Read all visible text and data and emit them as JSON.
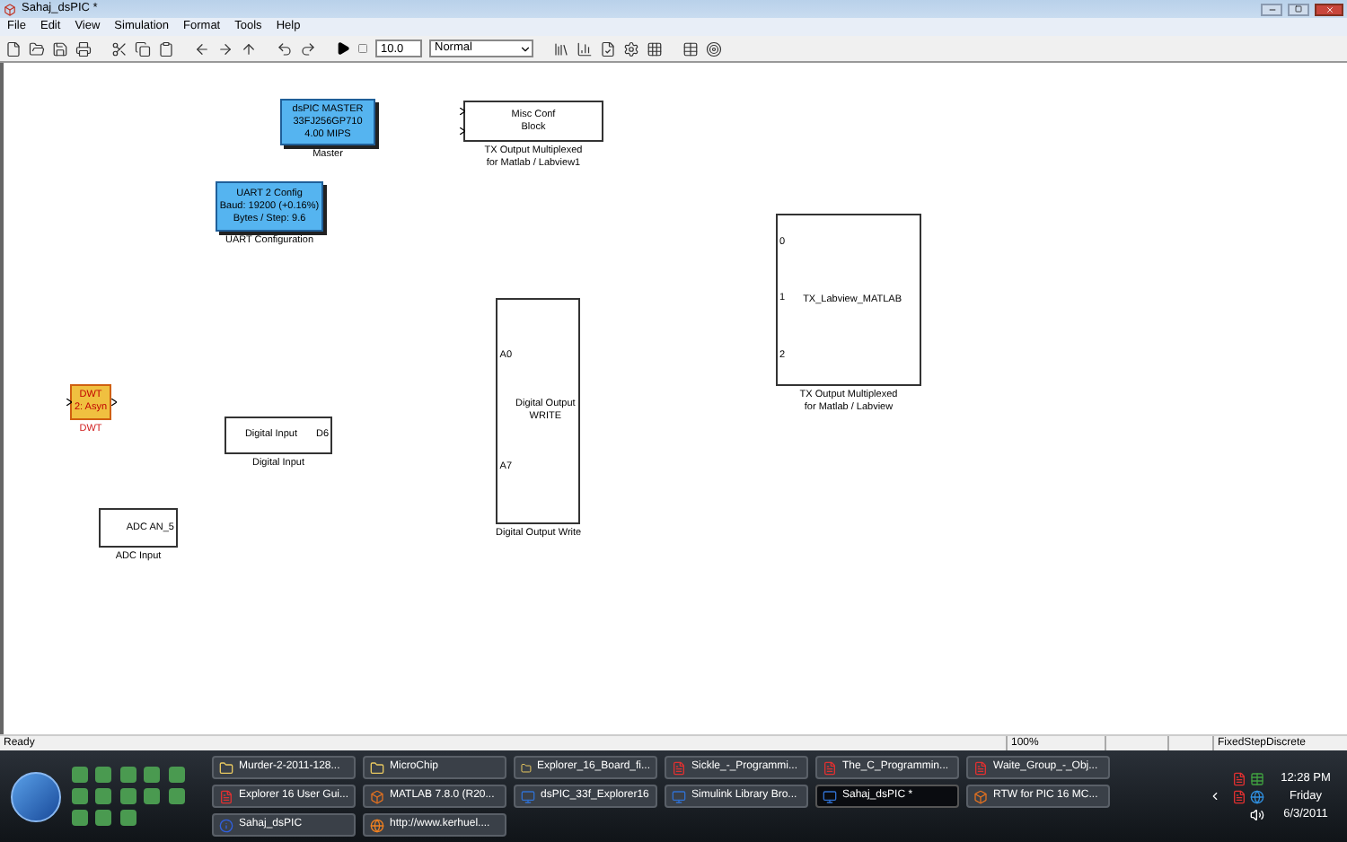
{
  "window": {
    "title": "Sahaj_dsPIC *"
  },
  "menu": [
    "File",
    "Edit",
    "View",
    "Simulation",
    "Format",
    "Tools",
    "Help"
  ],
  "toolbar": {
    "stop_time": "10.0",
    "mode": "Normal"
  },
  "blocks": [
    {
      "kind": "config",
      "lines": [
        "dsPIC MASTER",
        "33FJ256GP710",
        "4.00 MIPS"
      ],
      "label": [
        "Master"
      ]
    },
    {
      "kind": "plain",
      "lines": [
        "Misc Conf",
        "Block"
      ],
      "label": [
        "TX Output Multiplexed",
        "for Matlab / Labview1"
      ]
    },
    {
      "kind": "config",
      "lines": [
        "UART 2 Config",
        "Baud: 19200 (+0.16%)",
        "Bytes / Step: 9.6"
      ],
      "label": [
        "UART Configuration"
      ]
    },
    {
      "kind": "dwt",
      "lines": [
        "DWT",
        "2: Asyn"
      ],
      "label": [
        "DWT"
      ]
    },
    {
      "kind": "plain",
      "lines": [
        "Digital Input"
      ],
      "outputs": [
        "D6"
      ],
      "label": [
        "Digital Input"
      ]
    },
    {
      "kind": "plain",
      "outputs": [
        "ADC AN_5"
      ],
      "label": [
        "ADC Input"
      ]
    },
    {
      "kind": "plain",
      "lines": [
        "Digital Output",
        "WRITE"
      ],
      "inputs": [
        "A0",
        "A7"
      ],
      "label": [
        "Digital Output Write"
      ]
    },
    {
      "kind": "plain",
      "lines": [
        "TX_Labview_MATLAB"
      ],
      "inputs": [
        "0",
        "1",
        "2"
      ],
      "label": [
        "TX Output Multiplexed",
        "for Matlab / Labview"
      ]
    }
  ],
  "status_bar": {
    "message": "Ready",
    "zoom": "100%",
    "solver": "FixedStepDiscrete"
  },
  "taskbar": {
    "tasks": [
      {
        "title": "Murder-2-2011-128...",
        "kind": "folder",
        "selected": false
      },
      {
        "title": "MicroChip",
        "kind": "folder",
        "selected": false
      },
      {
        "title": "Explorer_16_Board_fi...",
        "kind": "folder",
        "selected": false
      },
      {
        "title": "Sickle_-_Programmi...",
        "kind": "pdf",
        "selected": false
      },
      {
        "title": "The_C_Programmin...",
        "kind": "pdf",
        "selected": false
      },
      {
        "title": "Waite_Group_-_Obj...",
        "kind": "pdf",
        "selected": false
      },
      {
        "title": "Explorer 16 User Gui...",
        "kind": "pdf",
        "selected": false
      },
      {
        "title": "MATLAB  7.8.0 (R20...",
        "kind": "matlab",
        "selected": false
      },
      {
        "title": "dsPIC_33f_Explorer16",
        "kind": "simulink",
        "selected": false
      },
      {
        "title": "Simulink Library Bro...",
        "kind": "simulink",
        "selected": false
      },
      {
        "title": "Sahaj_dsPIC *",
        "kind": "simulink",
        "selected": true
      },
      {
        "title": "RTW for PIC 16 MC...",
        "kind": "matlab",
        "selected": false
      },
      {
        "title": "Sahaj_dsPIC",
        "kind": "info",
        "selected": false
      },
      {
        "title": "http://www.kerhuel....",
        "kind": "firefox",
        "selected": false
      }
    ]
  },
  "clock": {
    "time": "12:28 PM",
    "day": "Friday",
    "date": "6/3/2011"
  }
}
